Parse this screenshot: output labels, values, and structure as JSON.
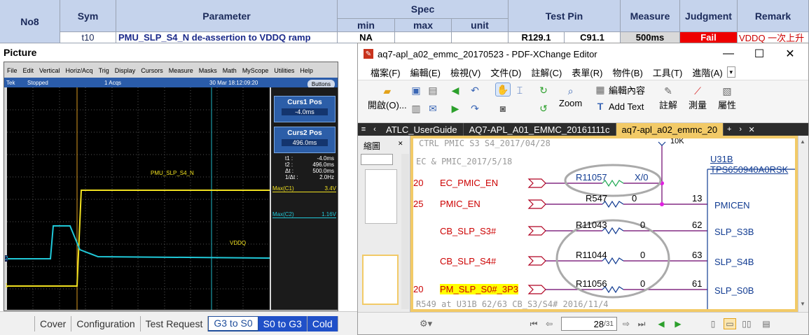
{
  "sheet": {
    "headers": {
      "no": "No8",
      "sym": "Sym",
      "parameter": "Parameter",
      "spec": "Spec",
      "min": "min",
      "max": "max",
      "unit": "unit",
      "test_pin": "Test Pin",
      "measure": "Measure",
      "judgment": "Judgment",
      "remark": "Remark"
    },
    "row": {
      "sym": "t10",
      "parameter": "PMU_SLP_S4_N de-assertion to VDDQ ramp",
      "min": "NA",
      "max": "",
      "unit": "",
      "pin1": "R129.1",
      "pin2": "C91.1",
      "measure": "500ms",
      "judgment": "Fail",
      "remark": "VDDQ 一次上升"
    },
    "picture_label": "Picture",
    "tabs": [
      {
        "label": "Cover",
        "state": "normal"
      },
      {
        "label": "Configuration",
        "state": "normal"
      },
      {
        "label": "Test Request",
        "state": "normal"
      },
      {
        "label": "G3 to S0",
        "state": "active"
      },
      {
        "label": "S0 to G3",
        "state": "blue"
      },
      {
        "label": "Cold",
        "state": "blue"
      }
    ],
    "colors": {
      "header_bg": "#c5d3ec",
      "fail_bg": "#ee0000",
      "accent_tab": "#2050c8"
    }
  },
  "scope": {
    "menu": [
      "File",
      "Edit",
      "Vertical",
      "Horiz/Acq",
      "Trig",
      "Display",
      "Cursors",
      "Measure",
      "Masks",
      "Math",
      "MyScope",
      "Utilities",
      "Help"
    ],
    "status": {
      "brand": "Tek",
      "state": "Stopped",
      "acqs": "1 Acqs",
      "datetime": "30 Mar 18:12:09:20"
    },
    "buttons_label": "Buttons",
    "curs1": {
      "title": "Curs1 Pos",
      "value": "-4.0ms"
    },
    "curs2": {
      "title": "Curs2 Pos",
      "value": "496.0ms"
    },
    "readout": {
      "t1_label": "t1 :",
      "t1": "-4.0ms",
      "t2_label": "t2 :",
      "t2": "496.0ms",
      "dt_label": "Δt :",
      "dt": "500.0ms",
      "inv_label": "1/Δt :",
      "inv": "2.0Hz"
    },
    "ch1": {
      "label": "PMU_SLP_S4_N",
      "max_label": "Max(C1)",
      "max_value": "3.4V",
      "marker": "1",
      "color": "#f0e020"
    },
    "ch2": {
      "label": "VDDQ",
      "max_label": "Max(C2)",
      "max_value": "1.16V",
      "marker": "2",
      "color": "#20c8d8"
    }
  },
  "pdf": {
    "title": "aq7-apl_a02_emmc_20170523 - PDF-XChange Editor",
    "menu": [
      "檔案(F)",
      "編輯(E)",
      "檢視(V)",
      "文件(D)",
      "註解(C)",
      "表單(R)",
      "物件(B)",
      "工具(T)",
      "進階(A)"
    ],
    "toolbar": {
      "open": "開啟(O)...",
      "zoom": "Zoom",
      "edit_content": "編輯內容",
      "add_text": "Add Text",
      "comment": "註解",
      "measure": "測量",
      "properties": "屬性"
    },
    "doc_tabs": [
      "ATLC_UserGuide",
      "AQ7-APL_A01_EMMC_20161111c",
      "aq7-apl_a02_emmc_20"
    ],
    "thumb_label": "縮圖",
    "page": {
      "current": "28",
      "total": "/31"
    },
    "schematic": {
      "top_note1": "CTRL PMIC S3 S4_2017/04/28",
      "top_note2": "EC & PMIC_2017/5/18",
      "bottom_note": "R549 at U31B 62/63 CB_S3/S4# 2016/11/4",
      "top_res": "10K",
      "ic_ref": "U31B",
      "ic_part": "TPS650940A0RSK",
      "nets": [
        {
          "num": "20",
          "name": "EC_PMIC_EN",
          "res": "R11057",
          "val": "X/0",
          "pin": "",
          "sig": ""
        },
        {
          "num": "25",
          "name": "PMIC_EN",
          "res": "R547",
          "val": "0",
          "pin": "13",
          "sig": "PMICEN"
        },
        {
          "num": "",
          "name": "CB_SLP_S3#",
          "res": "R11043",
          "val": "0",
          "pin": "62",
          "sig": "SLP_S3B"
        },
        {
          "num": "",
          "name": "CB_SLP_S4#",
          "res": "R11044",
          "val": "0",
          "pin": "63",
          "sig": "SLP_S4B"
        },
        {
          "num": "20",
          "name": "PM_SLP_S0#_3P3",
          "res": "R11056",
          "val": "0",
          "pin": "61",
          "sig": "SLP_S0B"
        }
      ]
    }
  }
}
